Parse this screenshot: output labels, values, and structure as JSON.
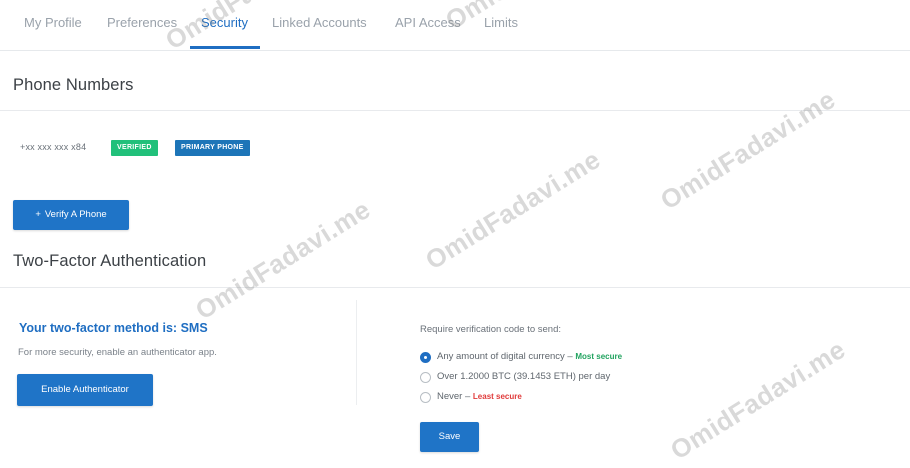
{
  "tabs": [
    {
      "label": "My Profile",
      "active": false
    },
    {
      "label": "Preferences",
      "active": false
    },
    {
      "label": "Security",
      "active": true
    },
    {
      "label": "Linked Accounts",
      "active": false
    },
    {
      "label": "API Access",
      "active": false
    },
    {
      "label": "Limits",
      "active": false
    }
  ],
  "phone_section": {
    "title": "Phone Numbers",
    "phone_number": "+xx xxx xxx x84",
    "badges": {
      "verified": "VERIFIED",
      "primary": "PRIMARY PHONE"
    },
    "verify_button": "Verify A Phone"
  },
  "two_factor": {
    "title": "Two-Factor Authentication",
    "method_title": "Your two-factor method is: SMS",
    "method_note": "For more security, enable an authenticator app.",
    "enable_button": "Enable Authenticator",
    "require_label": "Require verification code to send:",
    "options": [
      {
        "text": "Any amount of digital currency",
        "sep": " – ",
        "tag": "Most secure",
        "tag_color": "#21a35f",
        "selected": true
      },
      {
        "text": "Over 1.2000 BTC (39.1453 ETH) per day",
        "sep": "",
        "tag": "",
        "selected": false
      },
      {
        "text": "Never",
        "sep": " – ",
        "tag": "Least secure",
        "tag_color": "#e03b3b",
        "selected": false
      }
    ],
    "save_button": "Save"
  },
  "colors": {
    "accent": "#1f6ec2",
    "button": "#1f74c7",
    "verified_badge": "#21c07a",
    "primary_badge": "#1d75b8",
    "most_secure": "#21a35f",
    "least_secure": "#e03b3b"
  },
  "watermark": "OmidFadavi.me"
}
